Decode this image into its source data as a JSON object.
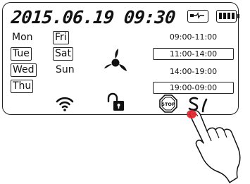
{
  "display": {
    "datetime": "2015.06.19 09:30"
  },
  "status": {
    "power_icon": "plug-icon",
    "battery_icon": "battery-full-icon"
  },
  "days": [
    {
      "label": "Mon",
      "selected": false
    },
    {
      "label": "Fri",
      "selected": true
    },
    {
      "label": "Tue",
      "selected": true
    },
    {
      "label": "Sat",
      "selected": true
    },
    {
      "label": "Wed",
      "selected": true
    },
    {
      "label": "Sun",
      "selected": false
    },
    {
      "label": "Thu",
      "selected": true
    }
  ],
  "schedule": [
    {
      "label": "09:00-11:00",
      "selected": false
    },
    {
      "label": "11:00-14:00",
      "selected": true
    },
    {
      "label": "14:00-19:00",
      "selected": false
    },
    {
      "label": "19:00-09:00",
      "selected": true
    }
  ],
  "icons": {
    "fan": "fan-icon",
    "wifi": "wifi-icon",
    "lock": "unlock-icon",
    "stop": "stop-icon",
    "stop_text": "STOP",
    "settings": "settings-icon",
    "hand": "pointing-hand-icon"
  },
  "colors": {
    "touch_point": "#e0242a",
    "lcd_ink": "#111111"
  }
}
